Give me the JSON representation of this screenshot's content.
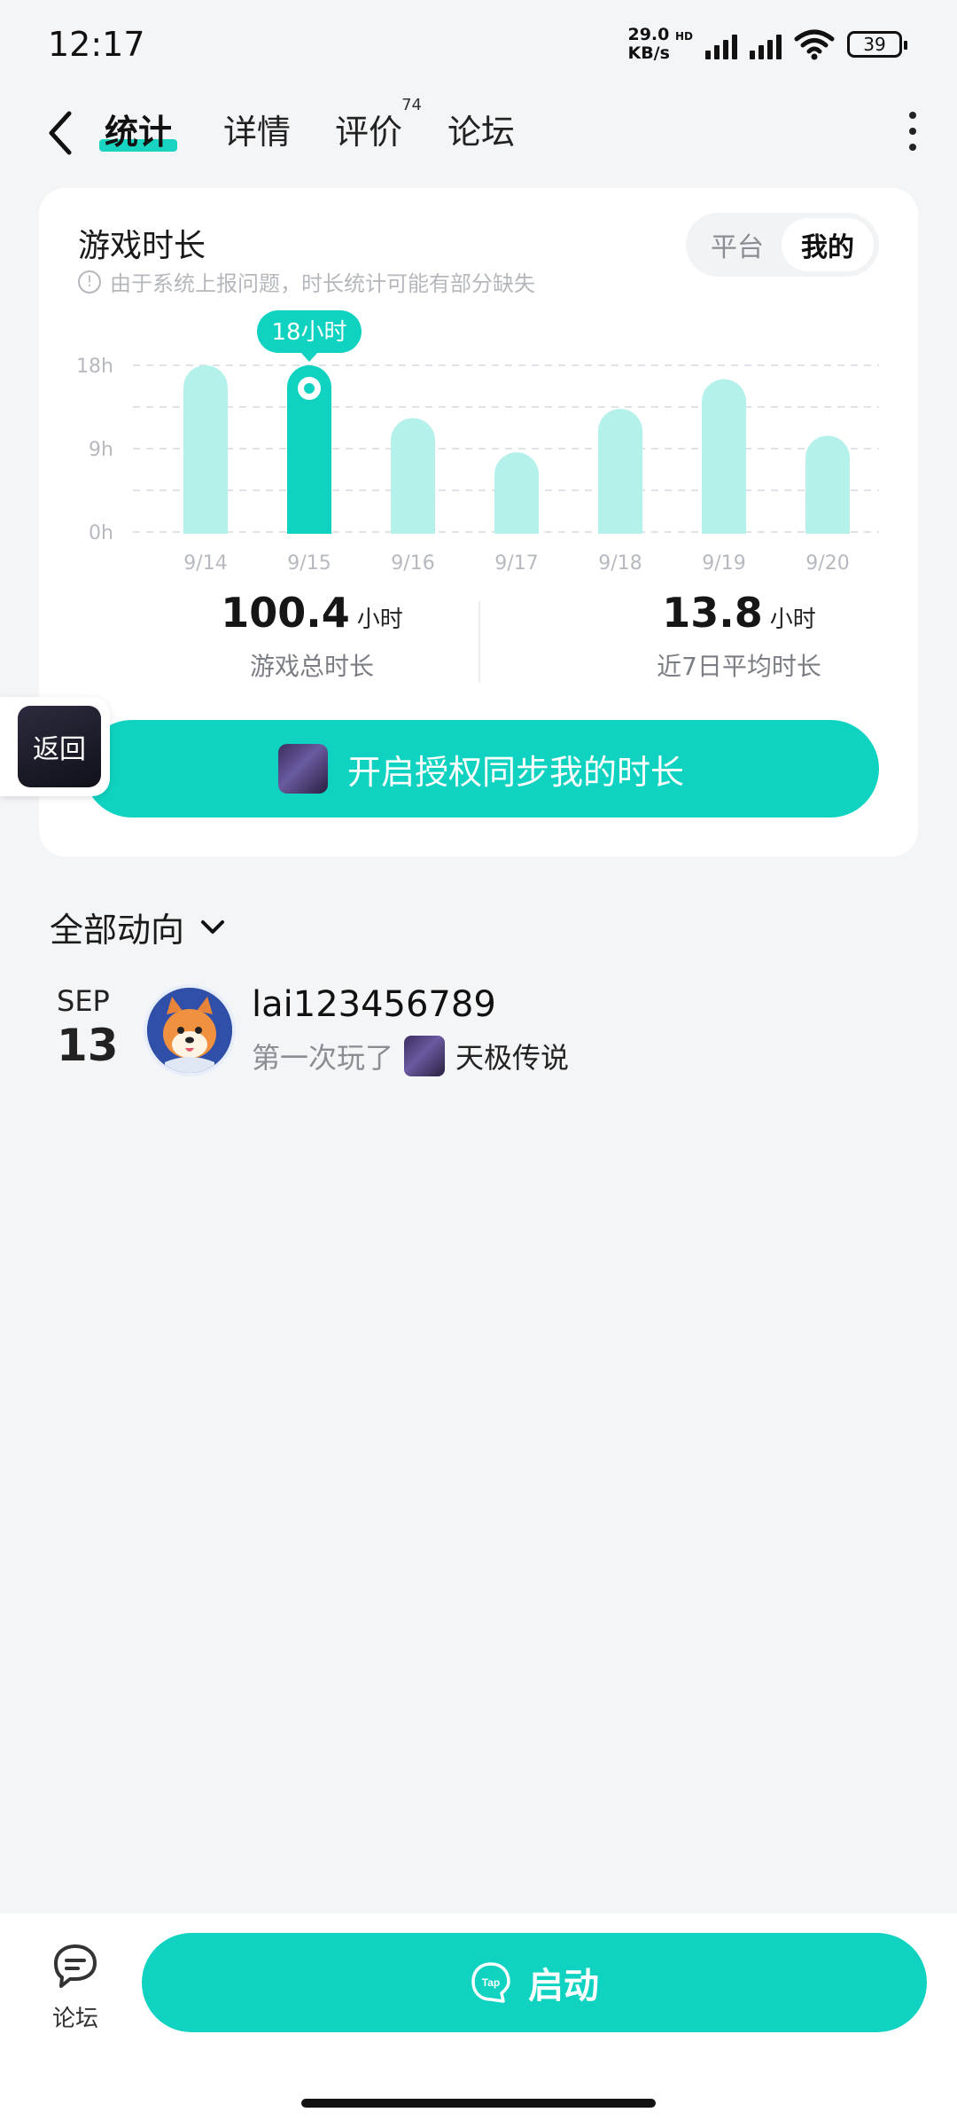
{
  "status_bar": {
    "time": "12:17",
    "net_speed_value": "29.0",
    "net_speed_unit": "KB/s",
    "hd": "HD",
    "battery": "39"
  },
  "nav": {
    "tabs": [
      {
        "label": "统计",
        "active": true
      },
      {
        "label": "详情"
      },
      {
        "label": "评价",
        "badge": "74"
      },
      {
        "label": "论坛"
      }
    ]
  },
  "card": {
    "title": "游戏时长",
    "note": "由于系统上报问题，时长统计可能有部分缺失",
    "toggle": {
      "left": "平台",
      "right": "我的"
    },
    "stats": [
      {
        "value": "100.4",
        "unit": "小时",
        "label": "游戏总时长"
      },
      {
        "value": "13.8",
        "unit": "小时",
        "label": "近7日平均时长"
      }
    ],
    "sync_button": "开启授权同步我的时长"
  },
  "chart_data": {
    "type": "bar",
    "categories": [
      "9/14",
      "9/15",
      "9/16",
      "9/17",
      "9/18",
      "9/19",
      "9/20"
    ],
    "values": [
      18,
      18,
      12.3,
      8.6,
      13.3,
      16.5,
      10.4
    ],
    "yticks": [
      "18h",
      "9h",
      "0h"
    ],
    "ylim": [
      0,
      18
    ],
    "highlight_index": 1,
    "tooltip": "18小时",
    "colors": {
      "bar": "#b4f1eb",
      "highlight": "#0fd3c0"
    }
  },
  "floating_back": {
    "label": "返回"
  },
  "activity": {
    "header": "全部动向",
    "items": [
      {
        "month": "SEP",
        "day": "13",
        "user": "lai123456789",
        "action": "第一次玩了",
        "game": "天极传说"
      }
    ]
  },
  "bottom": {
    "forum_label": "论坛",
    "launch_label": "启动",
    "tap_logo": "Tap"
  }
}
